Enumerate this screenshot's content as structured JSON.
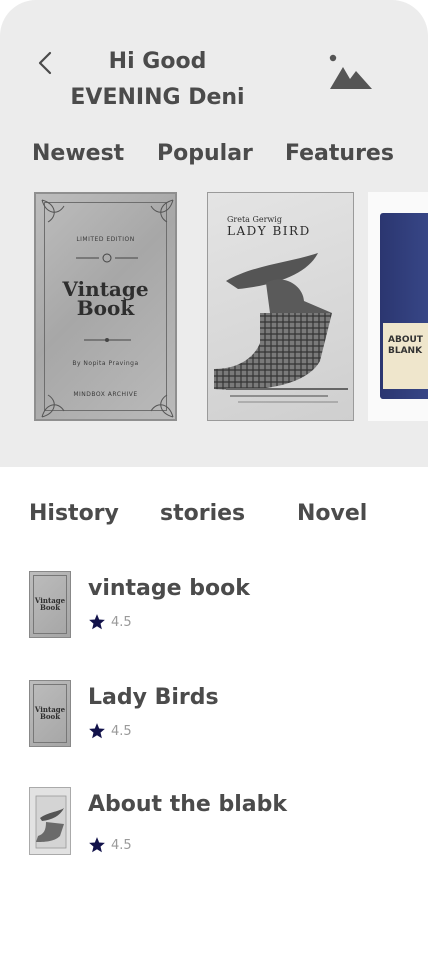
{
  "header": {
    "greeting_line1": "Hi Good",
    "greeting_line2": "EVENING Deni"
  },
  "top_tabs": [
    {
      "label": "Newest"
    },
    {
      "label": "Popular"
    },
    {
      "label": "Features"
    }
  ],
  "featured": [
    {
      "title_line1": "Vintage",
      "title_line2": "Book",
      "edition": "LIMITED EDITION",
      "byline": "By Nopita Pravinga",
      "publisher": "MINDBOX ARCHIVE"
    },
    {
      "author": "Greta Gerwig",
      "title": "LADY BIRD"
    },
    {
      "title_line1": "ABOUT",
      "title_line2": "BLANK"
    }
  ],
  "bottom_tabs": [
    {
      "label": "History"
    },
    {
      "label": "stories"
    },
    {
      "label": "Novel"
    }
  ],
  "book_list": [
    {
      "title": "vintage book",
      "rating": "4.5",
      "thumb_line1": "Vintage",
      "thumb_line2": "Book"
    },
    {
      "title": "Lady Birds",
      "rating": "4.5",
      "thumb_line1": "Vintage",
      "thumb_line2": "Book"
    },
    {
      "title": "About the blabk",
      "rating": "4.5"
    }
  ],
  "icons": {
    "back": "chevron-left-icon",
    "image": "image-icon",
    "rating": "star-icon"
  },
  "colors": {
    "panel_bg": "#ececec",
    "text": "#4b4b4b",
    "star": "#12124a",
    "rating_text": "#9a9a9a"
  }
}
